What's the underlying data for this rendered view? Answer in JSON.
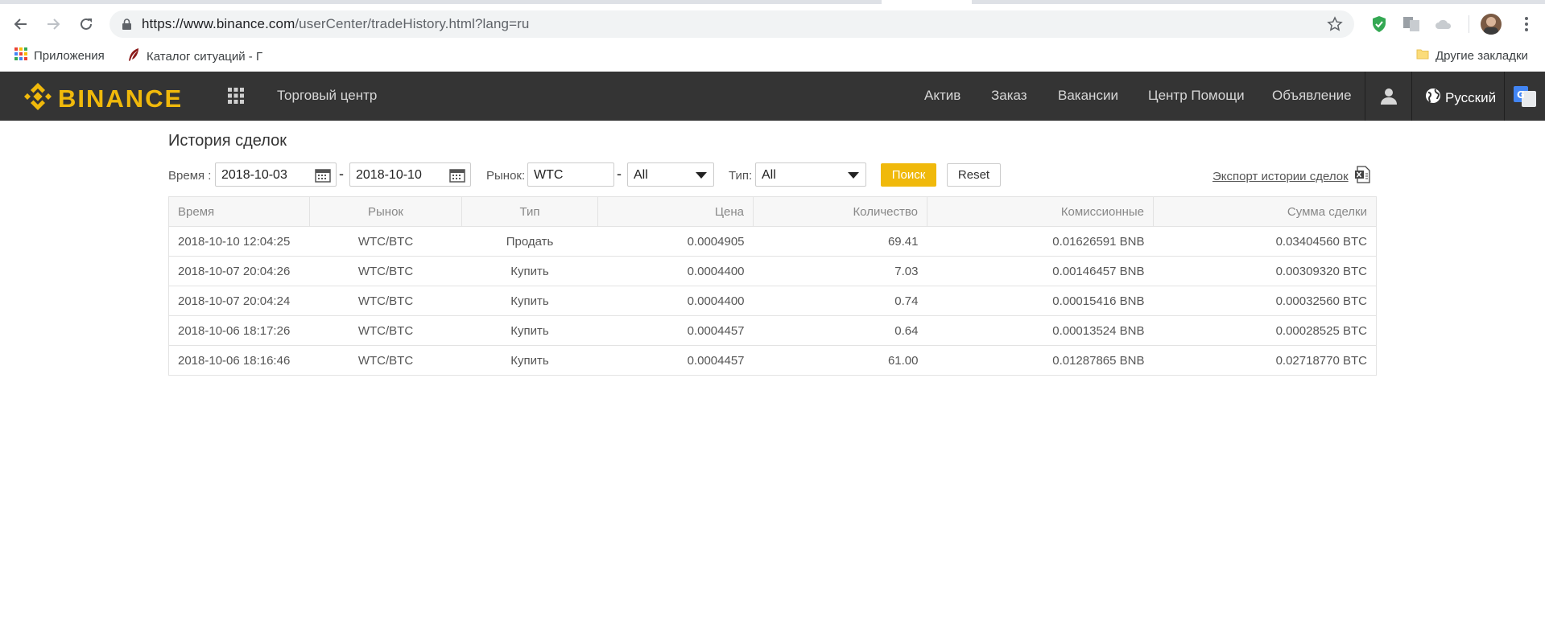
{
  "browser": {
    "url_main": "https://www.binance.com",
    "url_rest": "/userCenter/tradeHistory.html?lang=ru",
    "bookmarks": [
      {
        "label": "Приложения",
        "icon": "apps-grid-icon"
      },
      {
        "label": "Каталог ситуаций - Г",
        "icon": "feather-icon"
      }
    ],
    "other_bookmarks": "Другие закладки"
  },
  "nav": {
    "logo": "BINANCE",
    "trading_center": "Торговый центр",
    "items": [
      "Актив",
      "Заказ",
      "Вакансии",
      "Центр Помощи",
      "Объявление"
    ],
    "language": "Русский"
  },
  "page": {
    "title": "История сделок",
    "filters": {
      "time_label": "Время :",
      "date_from": "2018-10-03",
      "date_to": "2018-10-10",
      "market_label": "Рынок:",
      "market_base": "WTC",
      "market_quote": "All",
      "type_label": "Тип:",
      "type_value": "All",
      "search_button": "Поиск",
      "reset_button": "Reset",
      "export_link": "Экспорт истории сделок"
    },
    "table": {
      "columns": [
        "Время",
        "Рынок",
        "Тип",
        "Цена",
        "Количество",
        "Комиссионные",
        "Сумма сделки"
      ],
      "rows": [
        [
          "2018-10-10 12:04:25",
          "WTC/BTC",
          "Продать",
          "0.0004905",
          "69.41",
          "0.01626591 BNB",
          "0.03404560 BTC"
        ],
        [
          "2018-10-07 20:04:26",
          "WTC/BTC",
          "Купить",
          "0.0004400",
          "7.03",
          "0.00146457 BNB",
          "0.00309320 BTC"
        ],
        [
          "2018-10-07 20:04:24",
          "WTC/BTC",
          "Купить",
          "0.0004400",
          "0.74",
          "0.00015416 BNB",
          "0.00032560 BTC"
        ],
        [
          "2018-10-06 18:17:26",
          "WTC/BTC",
          "Купить",
          "0.0004457",
          "0.64",
          "0.00013524 BNB",
          "0.00028525 BTC"
        ],
        [
          "2018-10-06 18:16:46",
          "WTC/BTC",
          "Купить",
          "0.0004457",
          "61.00",
          "0.01287865 BNB",
          "0.02718770 BTC"
        ]
      ]
    }
  },
  "colors": {
    "brand": "#f0b90b",
    "nav_bg": "#343434",
    "sell": "#c2185b",
    "buy": "#7fa82a"
  }
}
